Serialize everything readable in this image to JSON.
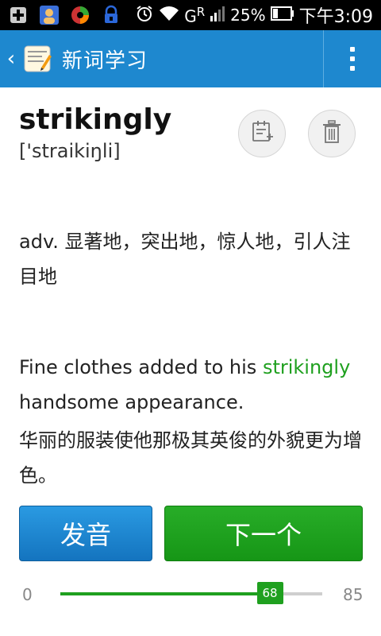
{
  "status_bar": {
    "network": "G",
    "network_sup": "R",
    "battery": "25%",
    "time": "下午3:09"
  },
  "appbar": {
    "title": "新词学习",
    "back_icon": "chevron-left-icon",
    "menu_icon": "overflow-menu-icon"
  },
  "word": {
    "text": "strikingly",
    "phonetic": "['straikiŋli]"
  },
  "actions": {
    "note_icon": "add-note-icon",
    "trash_icon": "trash-icon"
  },
  "definition": "adv. 显著地，突出地，惊人地，引人注目地",
  "example": {
    "before": "Fine clothes added to his ",
    "highlight": "strikingly",
    "after": " handsome appearance.",
    "translation": "华丽的服装使他那极其英俊的外貌更为增色。",
    "highlight_color": "#1fa01f"
  },
  "buttons": {
    "speak": "发音",
    "next": "下一个"
  },
  "progress": {
    "min": "0",
    "max": "85",
    "current": "68",
    "fraction": 0.8
  },
  "colors": {
    "appbar": "#1e88cf",
    "speak_button": "#1a86d4",
    "next_button": "#1fa01f"
  }
}
